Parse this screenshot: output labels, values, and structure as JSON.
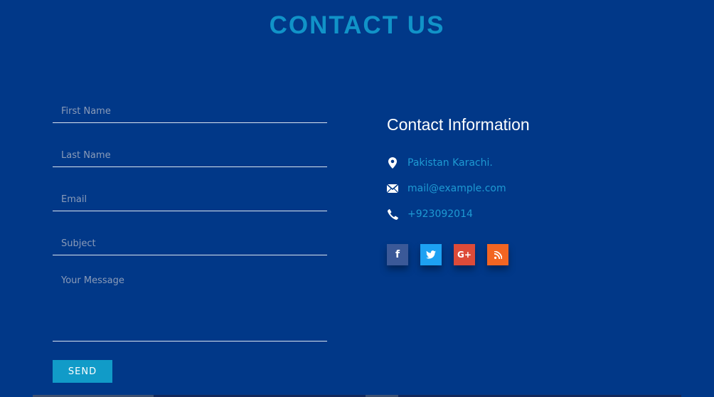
{
  "header": {
    "title": "CONTACT US"
  },
  "form": {
    "first_name_placeholder": "First Name",
    "last_name_placeholder": "Last Name",
    "email_placeholder": "Email",
    "subject_placeholder": "Subject",
    "message_placeholder": "Your Message",
    "send_label": "SEND"
  },
  "contact_info": {
    "title": "Contact Information",
    "address": "Pakistan Karachi.",
    "email": "mail@example.com",
    "phone": "+923092014",
    "address_icon": "map-marker-icon",
    "email_icon": "envelope-icon",
    "phone_icon": "phone-icon"
  },
  "social": [
    {
      "name": "facebook",
      "icon": "facebook-icon",
      "glyph": "f",
      "color": "#3b5998"
    },
    {
      "name": "twitter",
      "icon": "twitter-icon",
      "color": "#1da1f2"
    },
    {
      "name": "google-plus",
      "icon": "google-plus-icon",
      "glyph": "G+",
      "color": "#dd4b39"
    },
    {
      "name": "rss",
      "icon": "rss-icon",
      "color": "#f26522"
    }
  ],
  "colors": {
    "background": "#013888",
    "accent": "#119bc8",
    "title": "#1193c8",
    "link": "#1e9ad3"
  }
}
